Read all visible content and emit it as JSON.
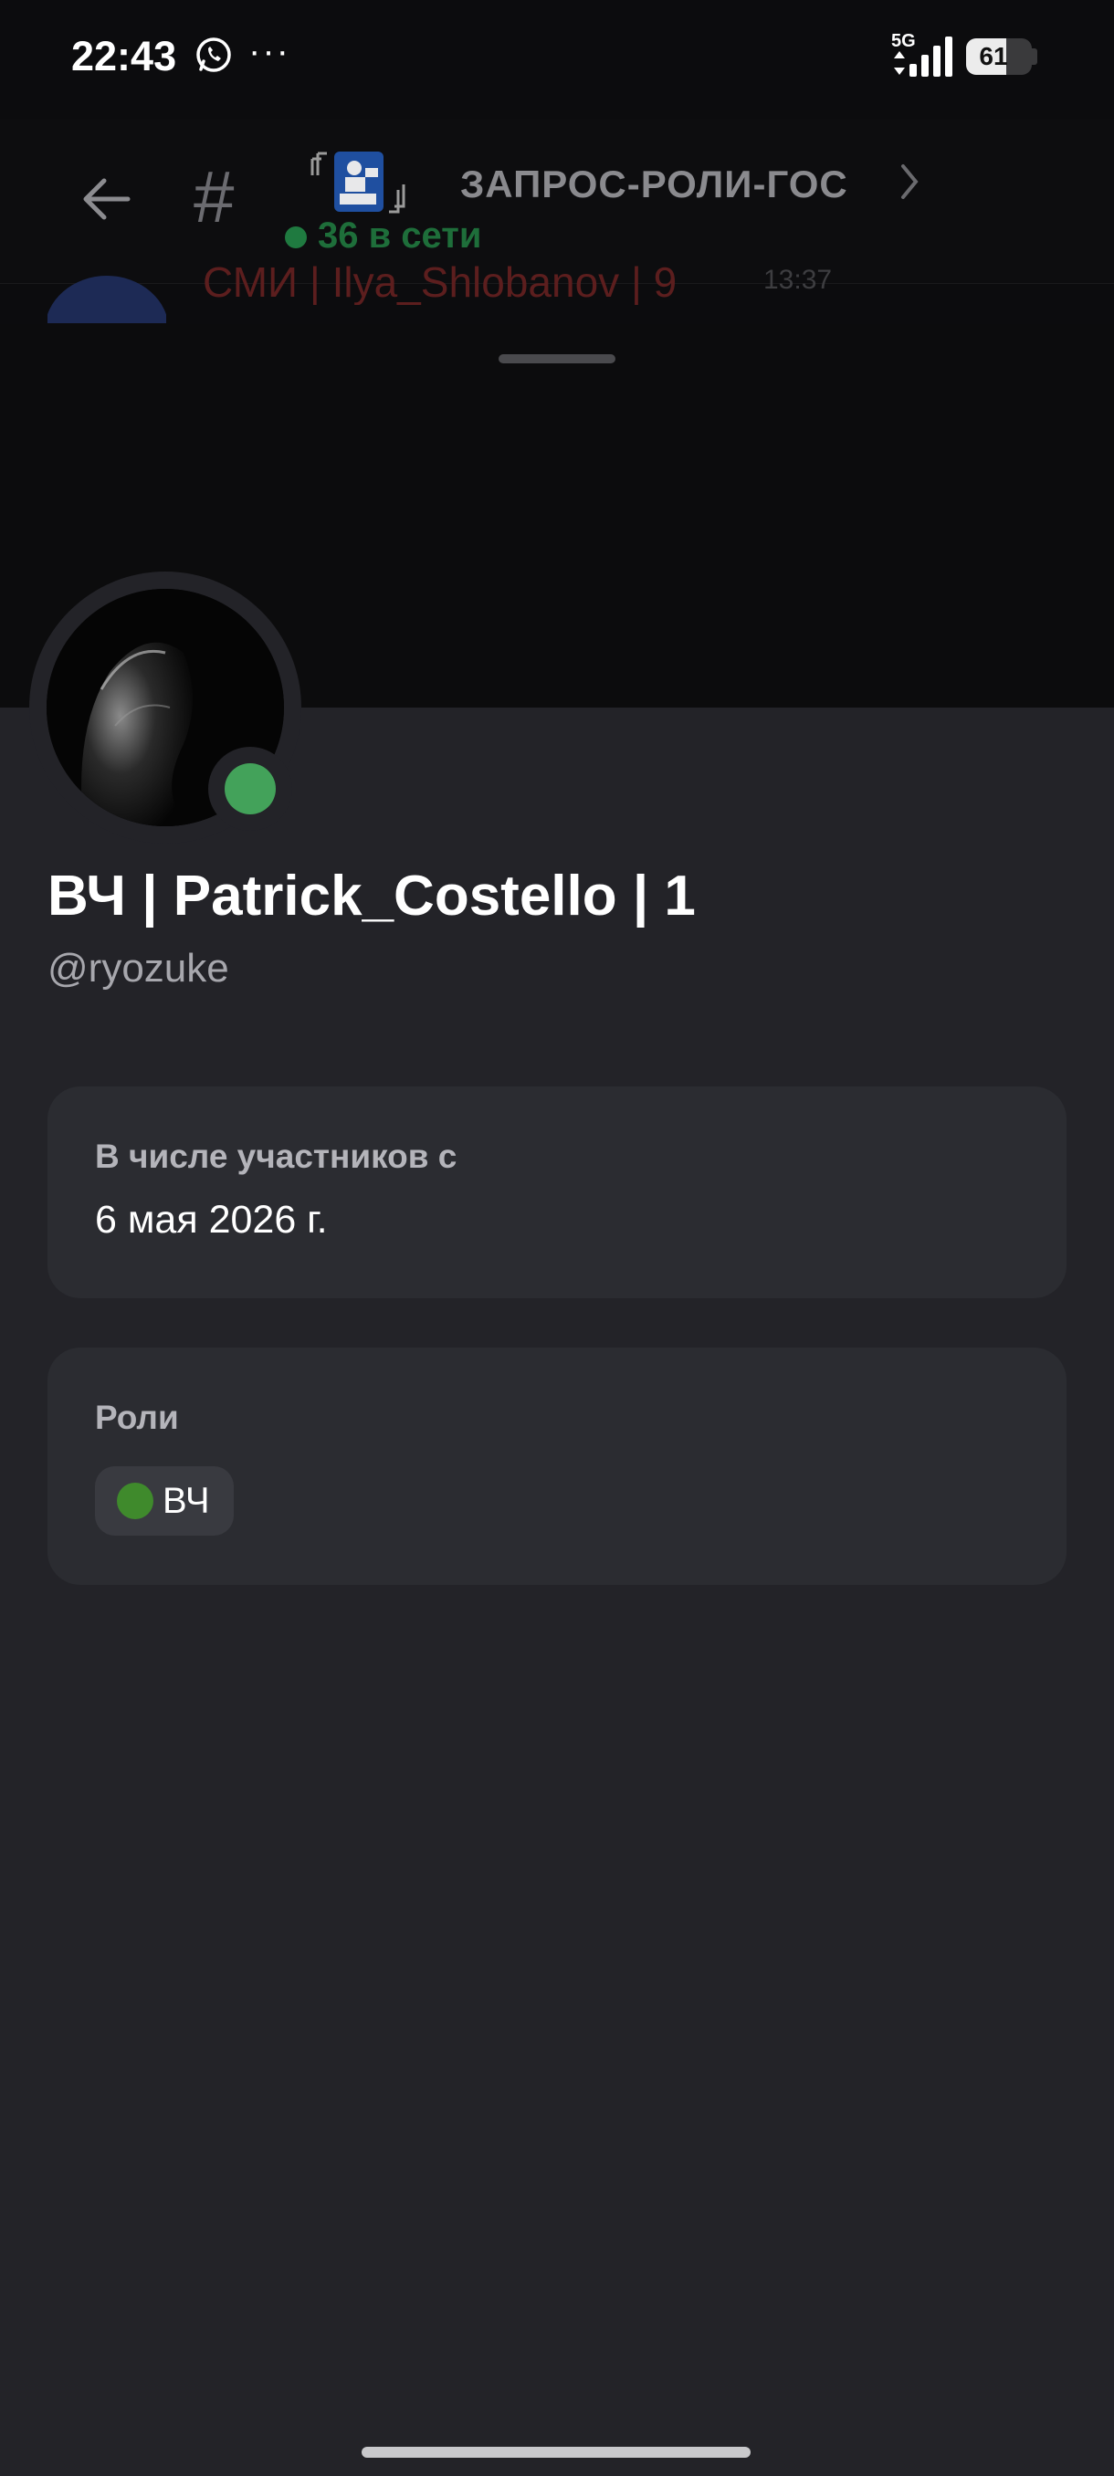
{
  "status_bar": {
    "time": "22:43",
    "network": "5G",
    "battery": "61",
    "battery_level": 0.61,
    "icons": [
      "whatsapp-icon",
      "more-dots-icon",
      "signal-icon",
      "battery-icon"
    ]
  },
  "header": {
    "channel_emoji": "『🛂』",
    "channel_name": "ЗАПРОС-РОЛИ-ГОС",
    "online_text": "36 в сети",
    "icons": [
      "back-arrow-icon",
      "hash-icon",
      "chevron-right-icon"
    ]
  },
  "background_message": {
    "author": "СМИ | Ilya_Shlobanov | 9",
    "time": "13:37"
  },
  "profile": {
    "display_name": "ВЧ | Patrick_Costello | 1",
    "username": "@ryozuke",
    "status": "online",
    "member_since_label": "В числе участников с",
    "member_since_value": "6 мая 2026 г.",
    "roles_label": "Роли",
    "roles": [
      {
        "name": "ВЧ",
        "color": "#3f8a2c"
      }
    ]
  },
  "colors": {
    "sheet_bg": "#232328",
    "card_bg": "#2b2c31",
    "online_green": "#43a25a"
  }
}
